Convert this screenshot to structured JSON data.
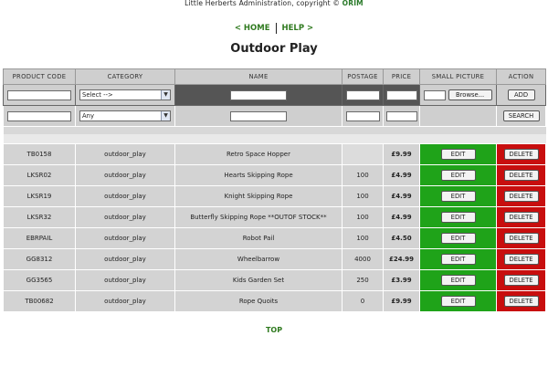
{
  "header": {
    "admin_text": "Little Herberts Administration, copyright ©",
    "brand": "ORIM"
  },
  "nav": {
    "home": "< HOME",
    "help": "HELP >"
  },
  "page_title": "Outdoor Play",
  "columns": [
    "PRODUCT CODE",
    "CATEGORY",
    "NAME",
    "POSTAGE",
    "PRICE",
    "SMALL PICTURE",
    "ACTION"
  ],
  "add_row": {
    "category_value": "Select -->",
    "browse_label": "Browse...",
    "add_label": "ADD"
  },
  "search_row": {
    "category_value": "Any",
    "search_label": "SEARCH"
  },
  "row_actions": {
    "edit_label": "EDIT",
    "delete_label": "DELETE"
  },
  "rows": [
    {
      "code": "TB0158",
      "category": "outdoor_play",
      "name": "Retro Space Hopper",
      "postage": "",
      "price": "£9.99"
    },
    {
      "code": "LKSR02",
      "category": "outdoor_play",
      "name": "Hearts Skipping Rope",
      "postage": "100",
      "price": "£4.99"
    },
    {
      "code": "LKSR19",
      "category": "outdoor_play",
      "name": "Knight Skipping Rope",
      "postage": "100",
      "price": "£4.99"
    },
    {
      "code": "LKSR32",
      "category": "outdoor_play",
      "name": "Butterfly Skipping Rope **OUTOF STOCK**",
      "postage": "100",
      "price": "£4.99"
    },
    {
      "code": "EBRPAIL",
      "category": "outdoor_play",
      "name": "Robot Pail",
      "postage": "100",
      "price": "£4.50"
    },
    {
      "code": "GG8312",
      "category": "outdoor_play",
      "name": "Wheelbarrow",
      "postage": "4000",
      "price": "£24.99"
    },
    {
      "code": "GG3565",
      "category": "outdoor_play",
      "name": "Kids Garden Set",
      "postage": "250",
      "price": "£3.99"
    },
    {
      "code": "TB00682",
      "category": "outdoor_play",
      "name": "Rope Quoits",
      "postage": "0",
      "price": "£9.99"
    }
  ],
  "footer": {
    "top_link": "TOP"
  },
  "colors": {
    "edit_bg": "#1fa319",
    "delete_bg": "#c80e0e",
    "link_green": "#2f7a1f"
  }
}
